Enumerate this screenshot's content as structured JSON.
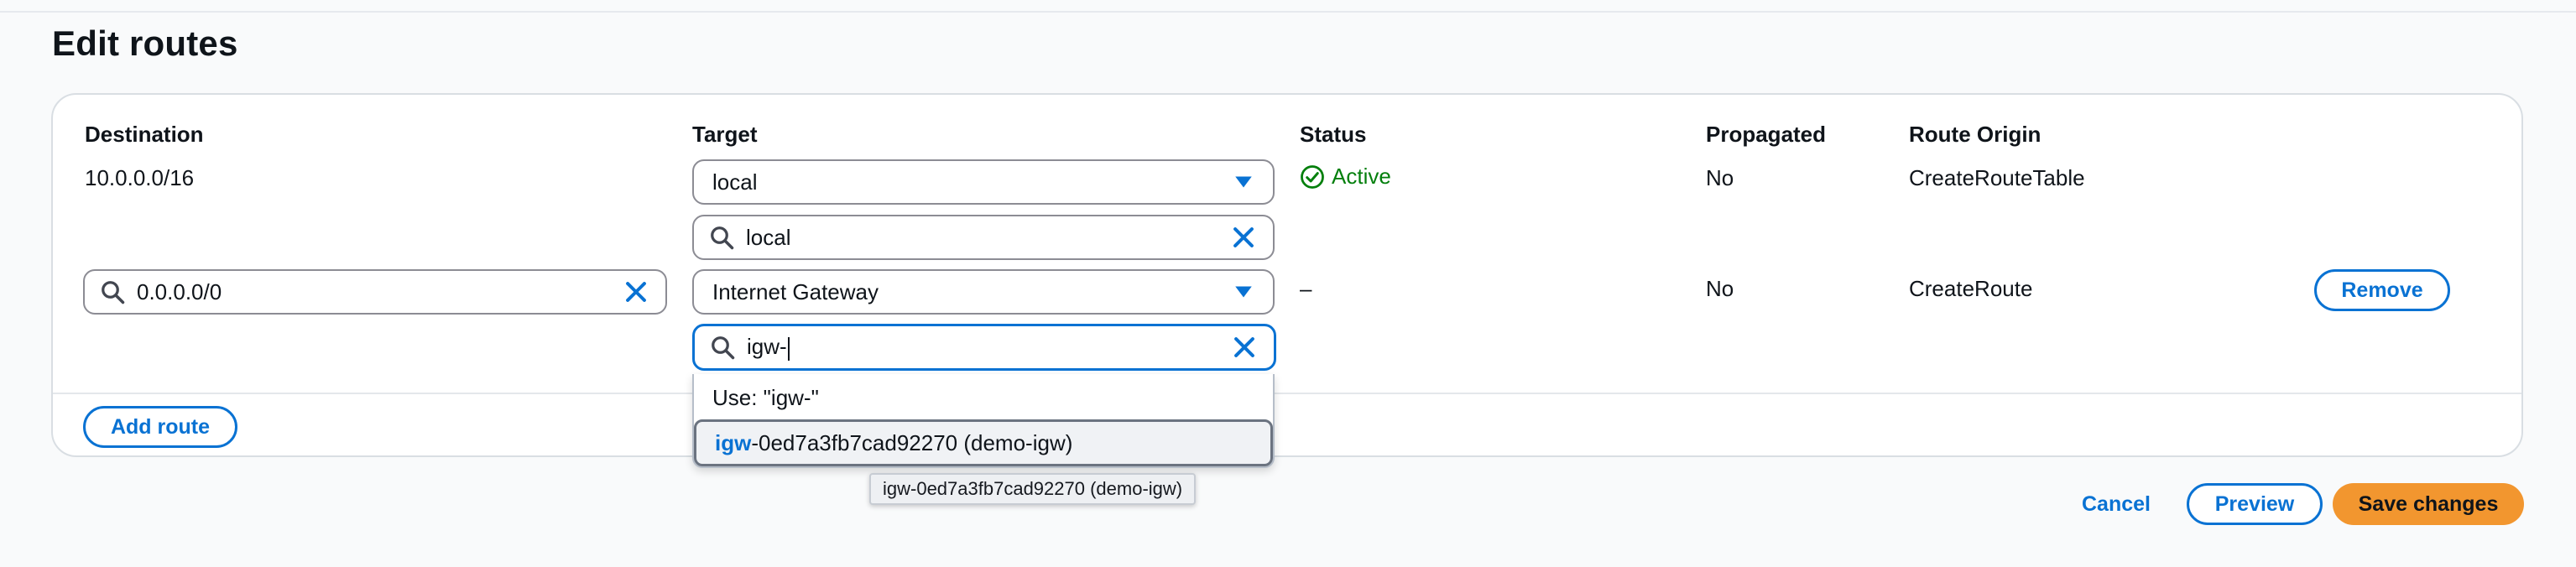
{
  "page": {
    "title": "Edit routes"
  },
  "columns": {
    "destination": "Destination",
    "target": "Target",
    "status": "Status",
    "propagated": "Propagated",
    "route_origin": "Route Origin"
  },
  "routes": [
    {
      "destination": "10.0.0.0/16",
      "target_type": "local",
      "target_search": "local",
      "status": "Active",
      "propagated": "No",
      "route_origin": "CreateRouteTable"
    },
    {
      "destination_input": "0.0.0.0/0",
      "target_type": "Internet Gateway",
      "target_search": "igw-",
      "status": "–",
      "propagated": "No",
      "route_origin": "CreateRoute",
      "remove_label": "Remove"
    }
  ],
  "dropdown": {
    "use_option": "Use: \"igw-\"",
    "suggestion_match": "igw",
    "suggestion_rest": "-0ed7a3fb7cad92270 (demo-igw)",
    "tooltip": "igw-0ed7a3fb7cad92270 (demo-igw)"
  },
  "actions": {
    "add_route": "Add route",
    "cancel": "Cancel",
    "preview": "Preview",
    "save": "Save changes"
  },
  "colors": {
    "accent": "#0972d3",
    "primary_button": "#f2962f",
    "status_active": "#037f0c"
  }
}
